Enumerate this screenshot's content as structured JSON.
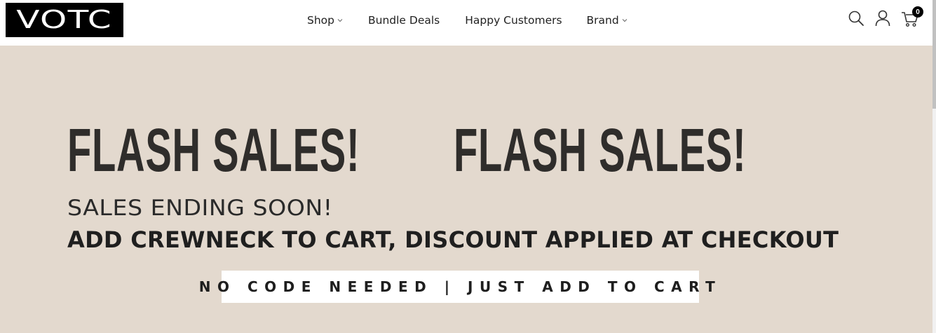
{
  "header": {
    "logo_text": "VOTC",
    "nav": [
      {
        "label": "Shop",
        "has_dropdown": true
      },
      {
        "label": "Bundle Deals",
        "has_dropdown": false
      },
      {
        "label": "Happy Customers",
        "has_dropdown": false
      },
      {
        "label": "Brand",
        "has_dropdown": true
      }
    ],
    "icons": [
      "search-icon",
      "account-icon",
      "cart-icon"
    ],
    "cart_count": "0"
  },
  "hero": {
    "background_color": "#e3d9ce",
    "headline_1": "FLASH SALES!",
    "headline_2": "FLASH SALES!",
    "subheadline": "SALES ENDING SOON!",
    "offer": "ADD CREWNECK TO CART, DISCOUNT APPLIED AT CHECKOUT",
    "code_note": "NO CODE NEEDED | JUST ADD TO CART"
  }
}
